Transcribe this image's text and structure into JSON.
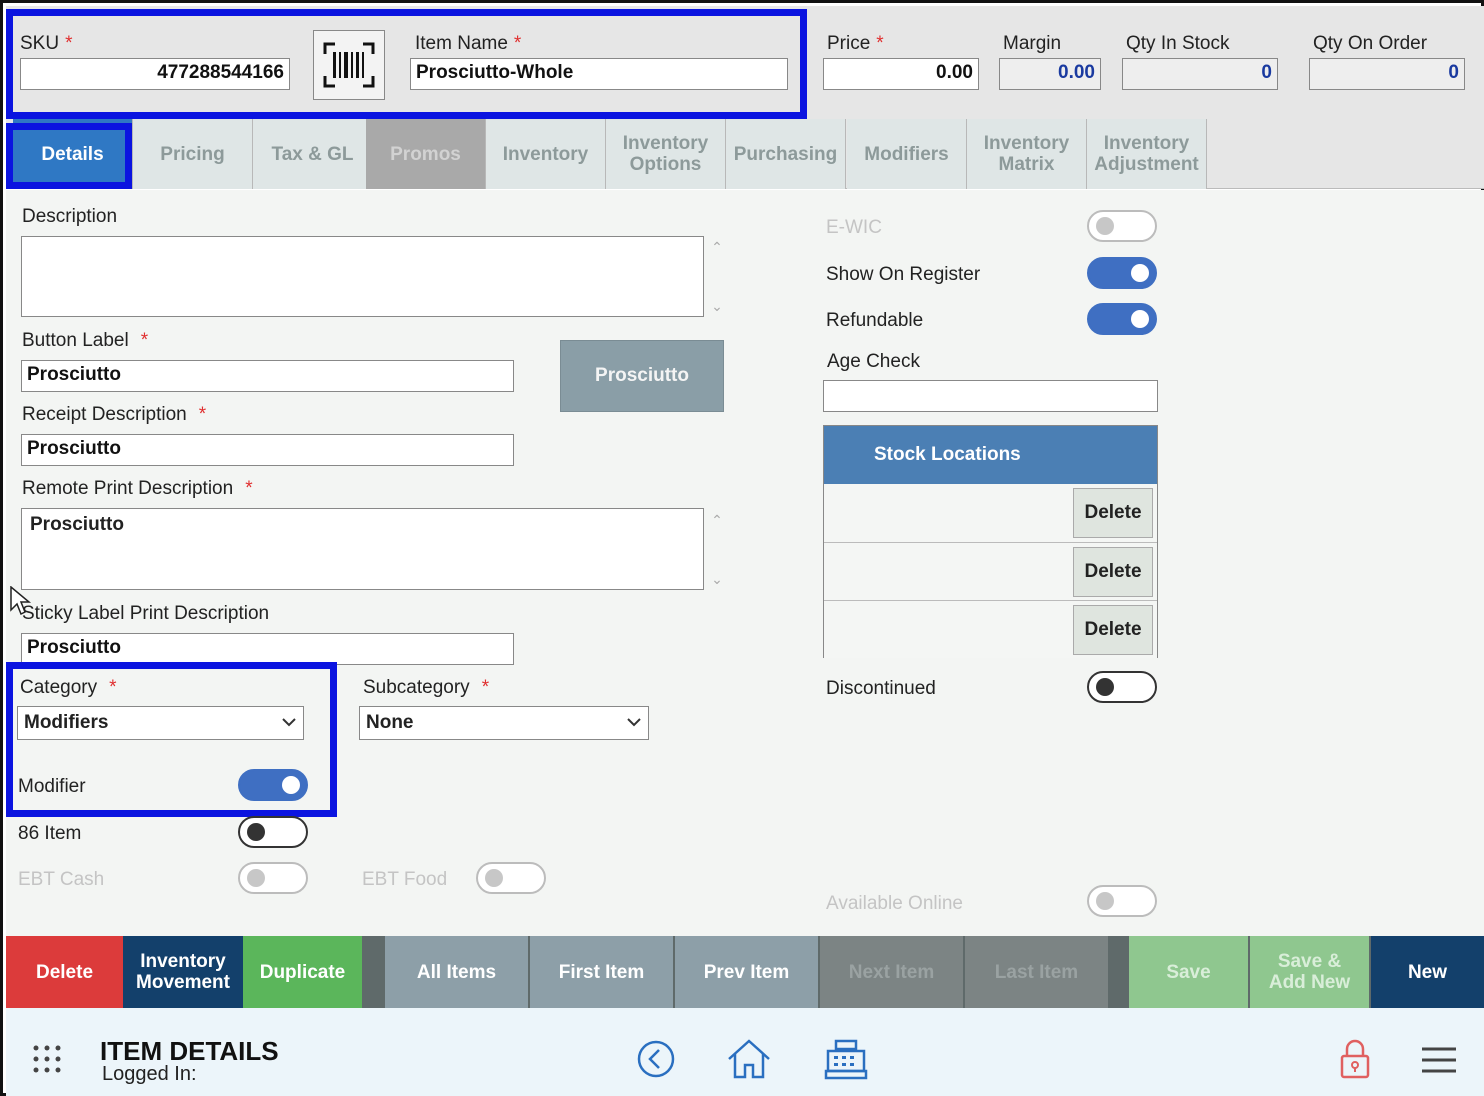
{
  "header": {
    "sku_label": "SKU",
    "sku_value": "477288544166",
    "item_name_label": "Item Name",
    "item_name_value": "Prosciutto-Whole",
    "price_label": "Price",
    "price_value": "0.00",
    "margin_label": "Margin",
    "margin_value": "0.00",
    "qty_in_stock_label": "Qty In Stock",
    "qty_in_stock_value": "0",
    "qty_on_order_label": "Qty On Order",
    "qty_on_order_value": "0",
    "required_mark": "*"
  },
  "tabs": [
    {
      "label": "Details",
      "state": "active"
    },
    {
      "label": "Pricing",
      "state": "normal"
    },
    {
      "label": "Tax & GL",
      "state": "normal"
    },
    {
      "label": "Promos",
      "state": "disabled"
    },
    {
      "label": "Inventory",
      "state": "normal"
    },
    {
      "label": "Inventory Options",
      "state": "normal"
    },
    {
      "label": "Purchasing",
      "state": "normal"
    },
    {
      "label": "Modifiers",
      "state": "normal"
    },
    {
      "label": "Inventory Matrix",
      "state": "normal"
    },
    {
      "label": "Inventory Adjustment",
      "state": "normal"
    }
  ],
  "details": {
    "description_label": "Description",
    "description_value": "",
    "button_label_label": "Button Label",
    "button_label_value": "Prosciutto",
    "button_preview": "Prosciutto",
    "receipt_desc_label": "Receipt Description",
    "receipt_desc_value": "Prosciutto",
    "remote_print_label": "Remote Print Description",
    "remote_print_value": "Prosciutto",
    "sticky_label_label": "Sticky Label Print Description",
    "sticky_label_value": "Prosciutto",
    "category_label": "Category",
    "category_value": "Modifiers",
    "subcategory_label": "Subcategory",
    "subcategory_value": "None",
    "modifier_label": "Modifier",
    "modifier_on": true,
    "item86_label": "86 Item",
    "item86_on": false,
    "ebt_cash_label": "EBT Cash",
    "ebt_food_label": "EBT Food"
  },
  "right_panel": {
    "ewic_label": "E-WIC",
    "show_on_register_label": "Show On Register",
    "show_on_register_on": true,
    "refundable_label": "Refundable",
    "refundable_on": true,
    "age_check_label": "Age Check",
    "age_check_value": "",
    "stock_locations_title": "Stock Locations",
    "stock_rows": [
      {
        "delete_label": "Delete"
      },
      {
        "delete_label": "Delete"
      },
      {
        "delete_label": "Delete"
      }
    ],
    "discontinued_label": "Discontinued",
    "discontinued_on": false,
    "available_online_label": "Available Online"
  },
  "actions": [
    {
      "label": "Delete",
      "color": "#dc3b3b"
    },
    {
      "label": "Inventory Movement",
      "color": "#13406b"
    },
    {
      "label": "Duplicate",
      "color": "#5bb65b"
    },
    {
      "label": "All Items",
      "color": "#8d9fa8"
    },
    {
      "label": "First Item",
      "color": "#8d9fa8"
    },
    {
      "label": "Prev Item",
      "color": "#8d9fa8"
    },
    {
      "label": "Next Item",
      "color": "#7c8484"
    },
    {
      "label": "Last Item",
      "color": "#7c8484"
    },
    {
      "label": "Save",
      "color": "#8fc78f"
    },
    {
      "label": "Save & Add New",
      "color": "#8fc78f"
    },
    {
      "label": "New",
      "color": "#13406b"
    }
  ],
  "footer": {
    "title": "ITEM DETAILS",
    "logged_in": "Logged In:",
    "icons": [
      "grid-icon",
      "back-icon",
      "home-icon",
      "register-icon",
      "lock-icon",
      "menu-icon"
    ]
  },
  "colors": {
    "highlight": "#0b14e0",
    "accent": "#3f6fc2",
    "required": "#e03030"
  }
}
